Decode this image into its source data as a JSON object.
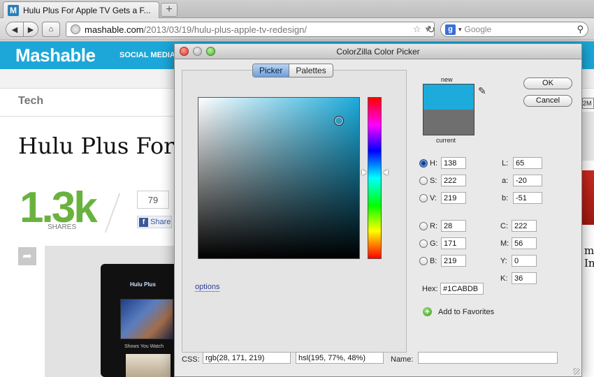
{
  "browser": {
    "tab_title": "Hulu Plus For Apple TV Gets a F...",
    "favicon_letter": "M",
    "url_domain": "mashable.com",
    "url_path": "/2013/03/19/hulu-plus-apple-tv-redesign/",
    "search_placeholder": "Google",
    "search_engine_letter": "g"
  },
  "page": {
    "logo": "Mashable",
    "nav_item": "SOCIAL MEDIA",
    "section": "Tech",
    "headline": "Hulu Plus For",
    "shares_count": "1.3k",
    "shares_label": "SHARES",
    "like_count": "79",
    "share_button": "Share",
    "tv_nav_label": "Hulu Plus",
    "tv_shows_label": "Shows You Watch",
    "right_btn_text": "2M",
    "right_text_line1": "ms",
    "right_text_line2": "Inf"
  },
  "dialog": {
    "title": "ColorZilla Color Picker",
    "tabs": [
      "Picker",
      "Palettes"
    ],
    "active_tab": "Picker",
    "options_link": "options",
    "new_label": "new",
    "current_label": "current",
    "new_color": "#1CABDB",
    "current_color": "#6F6F6F",
    "ok": "OK",
    "cancel": "Cancel",
    "fields": {
      "H": "138",
      "S": "222",
      "V": "219",
      "R": "28",
      "G": "171",
      "B": "219",
      "L": "65",
      "a": "-20",
      "b": "-51",
      "C": "222",
      "M": "56",
      "Y": "0",
      "K": "36",
      "Hex": "#1CABDB"
    },
    "selected_channel": "H",
    "add_favorites": "Add to Favorites",
    "css_label": "CSS:",
    "css_rgb": "rgb(28, 171, 219)",
    "css_hsl": "hsl(195, 77%, 48%)",
    "name_label": "Name:",
    "name_value": ""
  }
}
